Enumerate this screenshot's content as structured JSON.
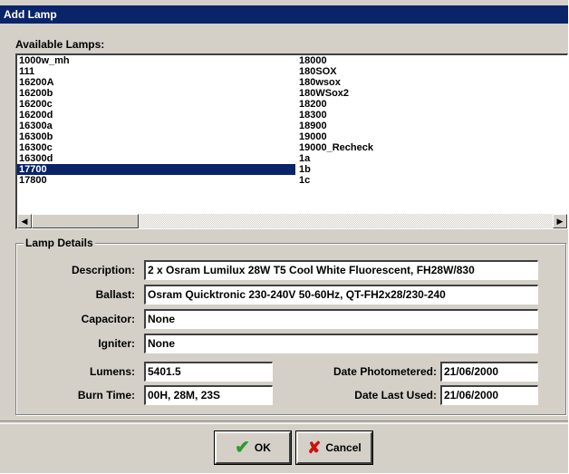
{
  "window": {
    "title": "Add Lamp"
  },
  "available_lamps": {
    "label": "Available Lamps:",
    "column1": [
      "1000w_mh",
      "111",
      "16200A",
      "16200b",
      "16200c",
      "16200d",
      "16300a",
      "16300b",
      "16300c",
      "16300d",
      "17700",
      "17800"
    ],
    "column2": [
      "18000",
      "180SOX",
      "180wsox",
      "180WSox2",
      "18200",
      "18300",
      "18900",
      "19000",
      "19000_Recheck",
      "1a",
      "1b",
      "1c"
    ],
    "selected": "17700",
    "scroll_left_icon": "arrow-left-icon",
    "scroll_right_icon": "arrow-right-icon"
  },
  "lamp_details": {
    "legend": "Lamp Details",
    "description_label": "Description:",
    "description_value": "2 x Osram Lumilux 28W T5 Cool White Fluorescent, FH28W/830",
    "ballast_label": "Ballast:",
    "ballast_value": "Osram Quicktronic 230-240V 50-60Hz, QT-FH2x28/230-240",
    "capacitor_label": "Capacitor:",
    "capacitor_value": "None",
    "igniter_label": "Igniter:",
    "igniter_value": "None",
    "lumens_label": "Lumens:",
    "lumens_value": "5401.5",
    "burn_time_label": "Burn Time:",
    "burn_time_value": "00H, 28M, 23S",
    "date_photometered_label": "Date Photometered:",
    "date_photometered_value": "21/06/2000",
    "date_last_used_label": "Date Last Used:",
    "date_last_used_value": "21/06/2000"
  },
  "buttons": {
    "ok_label": "OK",
    "ok_icon": "checkmark-icon",
    "cancel_label": "Cancel",
    "cancel_icon": "x-icon"
  },
  "colors": {
    "title_bar": "#0a246a",
    "selection": "#0a246a",
    "dialog_face": "#d4d0c8",
    "ok_icon": "#2e9a2e",
    "cancel_icon": "#cc1111"
  }
}
